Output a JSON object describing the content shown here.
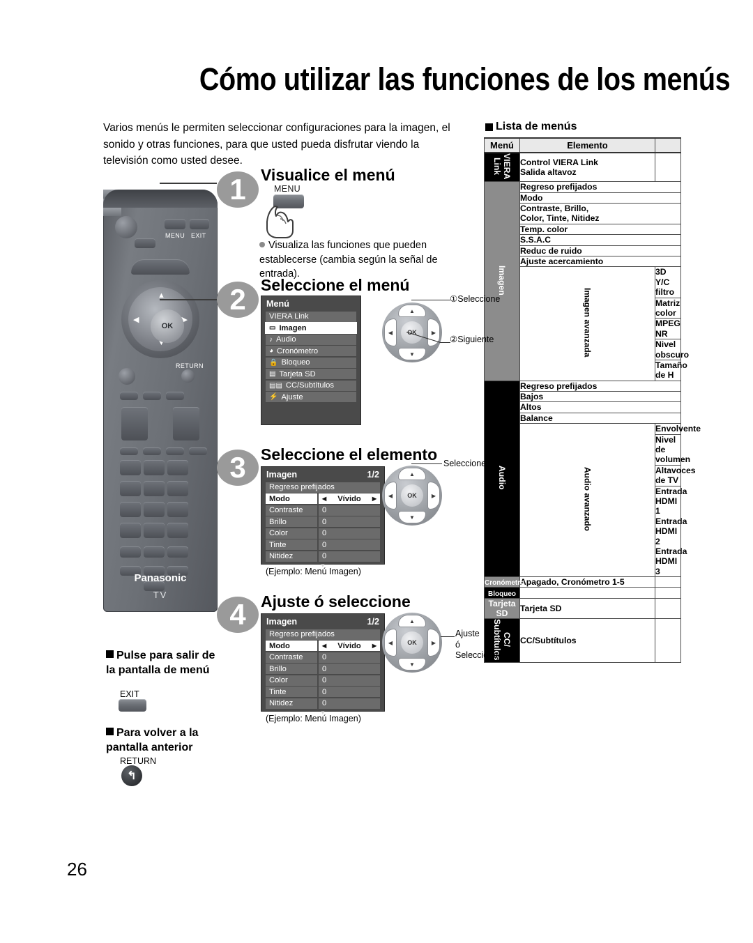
{
  "page": {
    "title": "Cómo utilizar las funciones de los menús",
    "page_number": "26",
    "intro": "Varios menús le permiten seleccionar configuraciones para la imagen, el sonido y otras funciones, para que usted pueda disfrutar viendo la televisión como usted desee."
  },
  "steps": [
    {
      "number": "1",
      "title": "Visualice el menú",
      "button_label": "MENU",
      "note": "Visualiza las funciones que pueden establecerse (cambia según la señal de entrada)."
    },
    {
      "number": "2",
      "title": "Seleccione el menú",
      "callout_1": "①Seleccione",
      "callout_2": "②Siguiente"
    },
    {
      "number": "3",
      "title": "Seleccione el elemento",
      "callout_1": "Seleccione",
      "caption": "(Ejemplo:  Menú Imagen)"
    },
    {
      "number": "4",
      "title": "Ajuste ó seleccione",
      "callout_1": "Ajuste\nó\nSeleccione",
      "caption": "(Ejemplo:  Menú Imagen)"
    }
  ],
  "osd_menu": {
    "header": "Menú",
    "items": [
      {
        "icon": "",
        "label": "VIERA Link",
        "selected": false
      },
      {
        "icon": "▭",
        "label": "Imagen",
        "selected": true
      },
      {
        "icon": "♪",
        "label": "Audio",
        "selected": false
      },
      {
        "icon": "◕",
        "label": "Cronómetro",
        "selected": false
      },
      {
        "icon": "🔒",
        "label": "Bloqueo",
        "selected": false
      },
      {
        "icon": "▤",
        "label": "Tarjeta SD",
        "selected": false
      },
      {
        "icon": "▤▤",
        "label": "CC/Subtítulos",
        "selected": false
      },
      {
        "icon": "⚡",
        "label": "Ajuste",
        "selected": false
      }
    ]
  },
  "osd_imagen": {
    "header": "Imagen",
    "page_indicator": "1/2",
    "first_row": "Regreso prefijados",
    "rows": [
      {
        "label": "Modo",
        "value": "Vívido",
        "selected": true,
        "arrows": true
      },
      {
        "label": "Contraste",
        "value": "0",
        "selected": false
      },
      {
        "label": "Brillo",
        "value": "0",
        "selected": false
      },
      {
        "label": "Color",
        "value": "0",
        "selected": false
      },
      {
        "label": "Tinte",
        "value": "0",
        "selected": false
      },
      {
        "label": "Nitidez",
        "value": "0",
        "selected": false
      }
    ]
  },
  "notes": [
    {
      "title": "Pulse para salir de la pantalla de menú",
      "button": "EXIT"
    },
    {
      "title": "Para volver a la pantalla anterior",
      "button": "RETURN"
    }
  ],
  "remote": {
    "brand": "Panasonic",
    "sub_brand": "TV",
    "menu_label": "MENU",
    "exit_label": "EXIT",
    "return_label": "RETURN",
    "ok_label": "OK"
  },
  "menu_list": {
    "heading": "Lista de menús",
    "columns": [
      "Menú",
      "Elemento",
      ""
    ],
    "groups": [
      {
        "category": "VIERA\nLink",
        "category_style": "black",
        "rows": [
          {
            "item": "Control VIERA Link\nSalida altavoz",
            "tall": true
          }
        ]
      },
      {
        "category": "Imagen",
        "category_style": "gray",
        "rows": [
          {
            "item": "Regreso prefijados"
          },
          {
            "item": "Modo"
          },
          {
            "item": "Contraste, Brillo,\nColor, Tinte, Nitidez",
            "tall": true
          },
          {
            "item": "Temp. color"
          },
          {
            "item": "S.S.A.C"
          },
          {
            "item": "Reduc de ruido"
          },
          {
            "item": "Ajuste acercamiento"
          }
        ],
        "subgroup": {
          "label": "Imagen avanzada",
          "rows": [
            {
              "item": "3D Y/C filtro"
            },
            {
              "item": "Matriz color",
              "tall": true
            },
            {
              "item": "MPEG NR"
            },
            {
              "item": "Nivel obscuro"
            },
            {
              "item": "Tamaño de H",
              "tall": true
            }
          ]
        }
      },
      {
        "category": "Audio",
        "category_style": "black",
        "rows": [
          {
            "item": "Regreso prefijados"
          },
          {
            "item": "Bajos"
          },
          {
            "item": "Altos"
          },
          {
            "item": "Balance"
          }
        ],
        "subgroup": {
          "label": "Audio avanzado",
          "rows": [
            {
              "item": "Envolvente"
            },
            {
              "item": "Nivel de volumen"
            },
            {
              "item": "Altavoces de  TV",
              "tall": true
            },
            {
              "item": "Entrada HDMI 1\nEntrada HDMI 2\nEntrada HDMI 3",
              "tall": true
            }
          ]
        }
      },
      {
        "category": "Cronómetro",
        "category_style": "gray-small",
        "rows": [
          {
            "item": "Apagado, Cronómetro 1-5"
          }
        ]
      },
      {
        "category": "Bloqueo",
        "category_style": "black-small",
        "rows": [
          {
            "item": ""
          }
        ]
      },
      {
        "category": "Tarjeta\nSD",
        "category_style": "gray",
        "rows": [
          {
            "item": "Tarjeta SD",
            "tall": true
          }
        ]
      },
      {
        "category": "CC/\nSubtítulos",
        "category_style": "black",
        "rows": [
          {
            "item": "CC/Subtítulos",
            "tall": true
          }
        ]
      }
    ]
  }
}
